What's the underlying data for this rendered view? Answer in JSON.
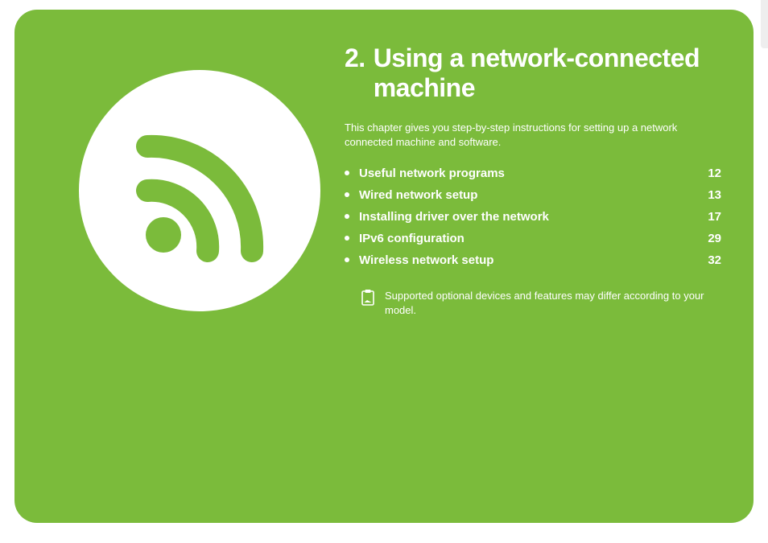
{
  "chapter": {
    "number": "2.",
    "title": "Using a network-connected machine"
  },
  "intro": "This chapter gives you step-by-step instructions for setting up a network connected machine and software.",
  "toc": [
    {
      "label": "Useful network programs",
      "page": "12"
    },
    {
      "label": "Wired network setup",
      "page": "13"
    },
    {
      "label": "Installing driver over the network",
      "page": "17"
    },
    {
      "label": "IPv6 configuration",
      "page": "29"
    },
    {
      "label": "Wireless network setup",
      "page": "32"
    }
  ],
  "note": "Supported optional devices and features may differ according to your model.",
  "colors": {
    "background": "#7bbb3b",
    "text": "#ffffff"
  }
}
